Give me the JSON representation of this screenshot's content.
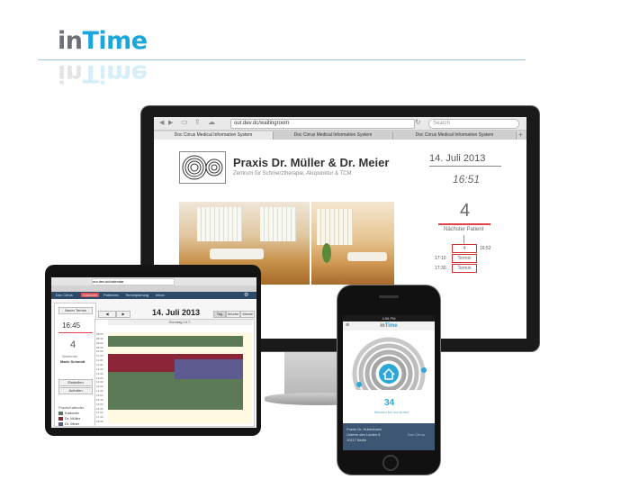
{
  "logo": {
    "in": "in",
    "time": "Time"
  },
  "colors": {
    "accent": "#1ba6dc",
    "red": "#e2424b",
    "nav": "#2e4a69"
  },
  "monitor": {
    "browser": {
      "url": "our.dev.dc/waitingroom",
      "search_placeholder": "Search",
      "tabs": [
        "Doc Cirrus Medical Information System",
        "Doc Cirrus Medical Information System",
        "Doc Cirrus Medical Information System"
      ]
    },
    "practice": {
      "name": "Praxis Dr. Müller & Dr. Meier",
      "subtitle": "Zentrum für Schmerztherapie, Akupunktur & TCM"
    },
    "display": {
      "date": "14. Juli 2013",
      "time": "16:51",
      "count": "4",
      "next_label": "Nächster Patient",
      "queue": [
        {
          "time": "",
          "label": "4",
          "end": "16:52"
        },
        {
          "time": "17:10",
          "label": "Termin"
        },
        {
          "time": "17:30",
          "label": "Termin"
        }
      ]
    }
  },
  "tablet": {
    "url": "our.dev.dc/calendar",
    "nav": [
      "Doc Cirrus",
      "Kalender",
      "Patienten",
      "Terminplanung",
      "Inbox"
    ],
    "new_button": "Neuer Termin",
    "time": "16:45",
    "count": "4",
    "count_label": "Wartende",
    "next_name": "Marie Schmidt",
    "title": "14. Juli 2013",
    "view_buttons": [
      "Tag",
      "Woche",
      "Monat"
    ],
    "day_label": "Sonntag 14.7.",
    "actions": [
      "Einstellen",
      "Aufrufen"
    ],
    "legend_label": "Praxis/Kalender",
    "legend": [
      "Kalender",
      "Dr. Müller",
      "Dr. Meier"
    ],
    "hours": [
      "08:00",
      "08:30",
      "09:00",
      "09:30",
      "10:00",
      "10:30",
      "11:00",
      "11:30",
      "12:00",
      "12:30",
      "13:00",
      "13:30",
      "14:00",
      "14:30",
      "15:00",
      "15:30",
      "16:00",
      "16:30",
      "17:00",
      "17:30",
      "18:00"
    ]
  },
  "phone": {
    "status": "4:56 PM",
    "brand_in": "in",
    "brand_time": "Time",
    "count": "34",
    "count_label": "Minuten bis zur Aufruf",
    "footer_lines": [
      "Praxis Dr. Hubenbach",
      "Unterm den Linden 5",
      "10117 Berlin"
    ],
    "footer_brand": "Doc Cirrus"
  }
}
